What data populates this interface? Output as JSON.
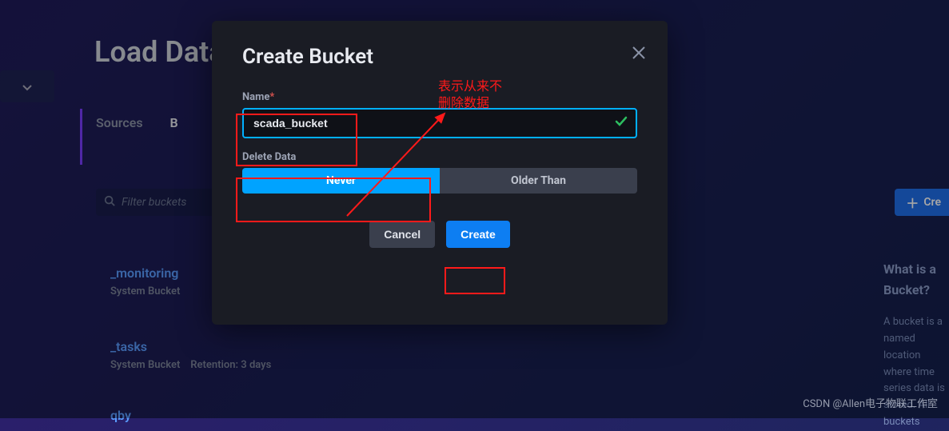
{
  "page": {
    "title": "Load Data"
  },
  "tabs": {
    "sources": "Sources",
    "buckets": "B"
  },
  "filter": {
    "placeholder": "Filter buckets"
  },
  "createBucketBtn": {
    "label": "Cre"
  },
  "bucketList": [
    {
      "name": "_monitoring",
      "subtitle": "System Bucket",
      "retention": ""
    },
    {
      "name": "_tasks",
      "subtitle": "System Bucket",
      "retention": "Retention: 3 days"
    },
    {
      "name": "qby",
      "subtitle": "",
      "retention": ""
    }
  ],
  "infoPanel": {
    "heading": "What is a Bucket?",
    "body": "A bucket is a named location where time series data is stored. All buckets "
  },
  "modal": {
    "title": "Create Bucket",
    "nameLabel": "Name",
    "nameValue": "scada_bucket",
    "deleteLabel": "Delete Data",
    "toggle": {
      "never": "Never",
      "olderThan": "Older Than"
    },
    "cancel": "Cancel",
    "create": "Create"
  },
  "annotation": {
    "text": "表示从来不\n删除数据"
  },
  "watermark": "CSDN @Allen电子物联工作室"
}
